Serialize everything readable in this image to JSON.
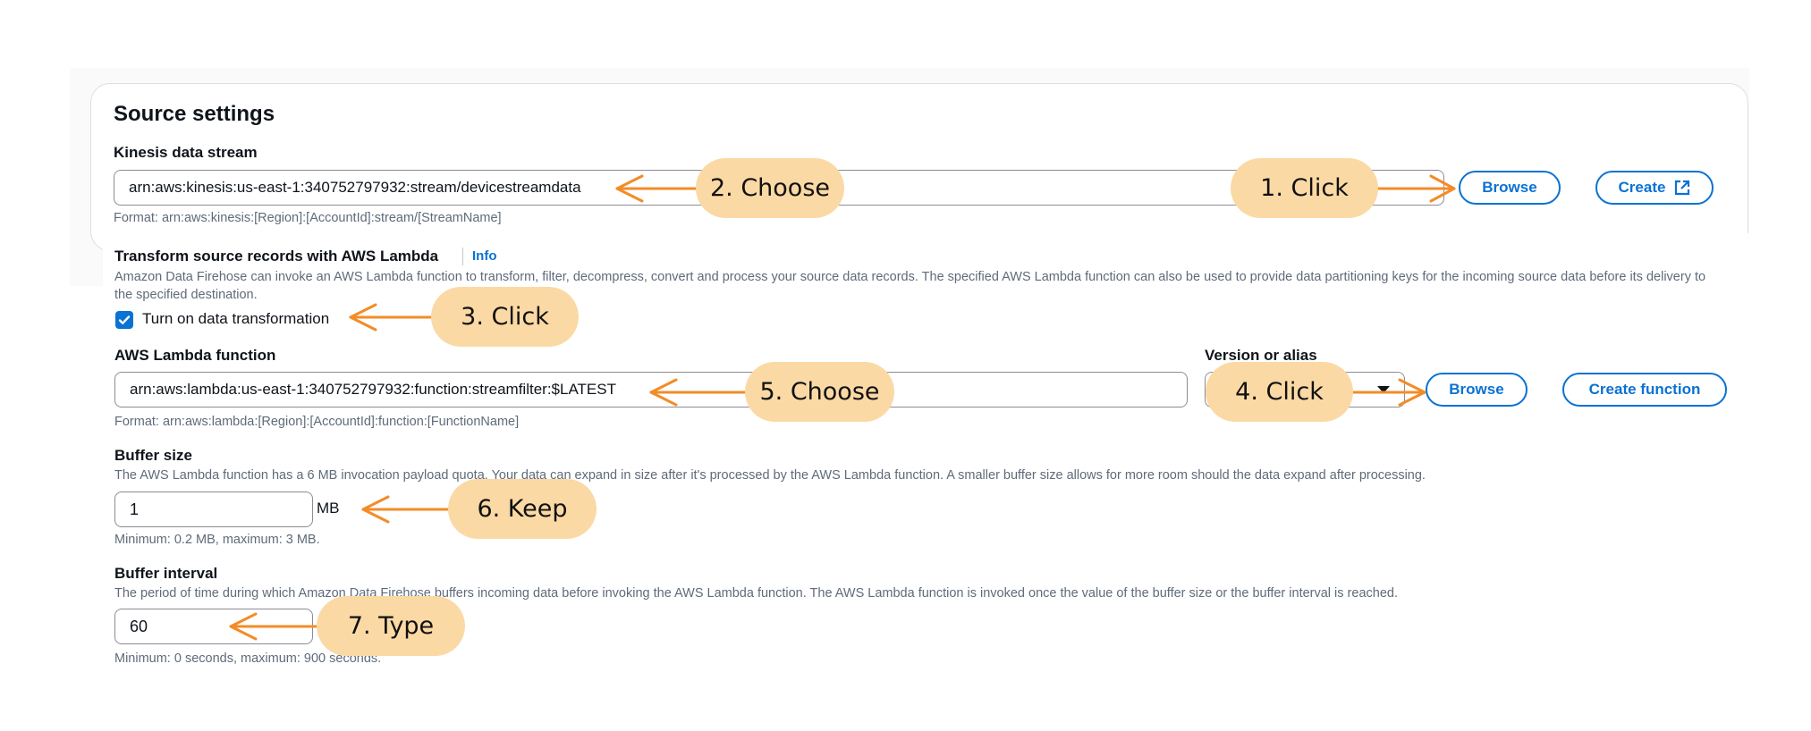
{
  "source_settings": {
    "title": "Source settings",
    "stream_label": "Kinesis data stream",
    "stream_value": "arn:aws:kinesis:us-east-1:340752797932:stream/devicestreamdata",
    "stream_format": "Format: arn:aws:kinesis:[Region]:[AccountId]:stream/[StreamName]",
    "browse_label": "Browse",
    "create_label": "Create"
  },
  "transform": {
    "title": "Transform source records with AWS Lambda",
    "info_label": "Info",
    "description": "Amazon Data Firehose can invoke an AWS Lambda function to transform, filter, decompress, convert and process your source data records. The specified AWS Lambda function can also be used to provide data partitioning keys for the incoming source data before its delivery to the specified destination.",
    "checkbox_label": "Turn on data transformation",
    "checkbox_checked": true
  },
  "lambda": {
    "label": "AWS Lambda function",
    "value": "arn:aws:lambda:us-east-1:340752797932:function:streamfilter:$LATEST",
    "format": "Format: arn:aws:lambda:[Region]:[AccountId]:function:[FunctionName]",
    "version_label": "Version or alias",
    "browse_label": "Browse",
    "create_function_label": "Create function"
  },
  "buffer_size": {
    "label": "Buffer size",
    "description": "The AWS Lambda function has a 6 MB invocation payload quota. Your data can expand in size after it's processed by the AWS Lambda function. A smaller buffer size allows for more room should the data expand after processing.",
    "value": "1",
    "unit": "MB",
    "constraint": "Minimum: 0.2 MB, maximum: 3 MB."
  },
  "buffer_interval": {
    "label": "Buffer interval",
    "description": "The period of time during which Amazon Data Firehose buffers incoming data before invoking the AWS Lambda function. The AWS Lambda function is invoked once the value of the buffer size or the buffer interval is reached.",
    "value": "60",
    "constraint": "Minimum: 0 seconds, maximum: 900 seconds."
  },
  "annotations": [
    "1. Click",
    "2. Choose",
    "3. Click",
    "4. Click",
    "5. Choose",
    "6. Keep",
    "7. Type"
  ],
  "colors": {
    "accent": "#0972d3",
    "callout": "#fbd9a5",
    "arrow": "#f28c28"
  }
}
